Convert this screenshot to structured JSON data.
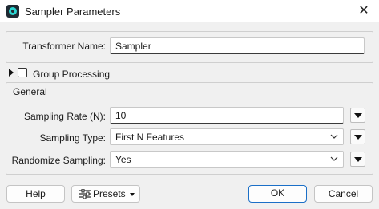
{
  "window": {
    "title": "Sampler Parameters",
    "close_glyph": "✕"
  },
  "transformer": {
    "label": "Transformer Name:",
    "value": "Sampler"
  },
  "group_processing": {
    "label": "Group Processing",
    "checked": false
  },
  "general": {
    "title": "General",
    "sampling_rate": {
      "label": "Sampling Rate (N):",
      "value": "10"
    },
    "sampling_type": {
      "label": "Sampling Type:",
      "value": "First N Features"
    },
    "randomize": {
      "label": "Randomize Sampling:",
      "value": "Yes"
    }
  },
  "footer": {
    "help": "Help",
    "presets": "Presets",
    "ok": "OK",
    "cancel": "Cancel"
  },
  "colors": {
    "accent": "#1b6fc7",
    "app_icon": "#2bd4d0"
  }
}
